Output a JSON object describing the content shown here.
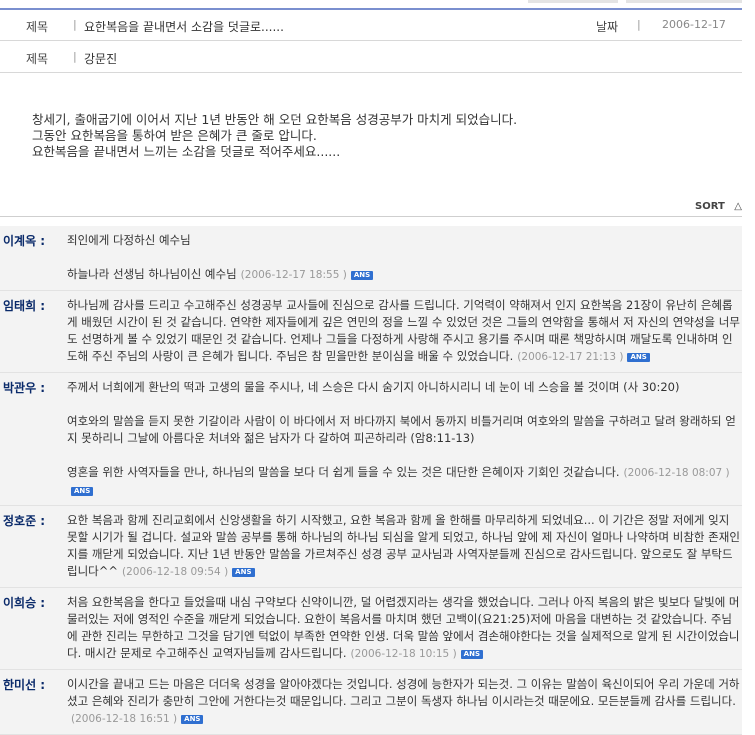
{
  "header": {
    "title_label": "제목",
    "title_value": "요한복음을 끝내면서 소감을 덧글로......",
    "date_label": "날짜",
    "date_value": "2006-12-17",
    "author_label": "제목",
    "author_value": "강문진"
  },
  "post_body": [
    "창세기, 출애굽기에 이어서 지난 1년 반동안 해 오던 요한복음 성경공부가 마치게 되었습니다.",
    "그동안 요한복음을 통하여 받은 은혜가 큰 줄로 압니다.",
    "요한복음을 끝내면서 느끼는 소감을 덧글로 적어주세요......"
  ],
  "sort_label": "SORT",
  "sort_icon": "triangle-up-icon",
  "ans_label": "ANS",
  "colors": {
    "accent": "#7a8fcf",
    "name": "#0a2a6a",
    "ans": "#2f6fd0",
    "comment_bg": "#f3f3f3"
  },
  "comments": [
    {
      "name": "이계옥 :",
      "paragraphs": [
        "죄인에게 다정하신 예수님",
        "하늘나라 선생님 하나님이신 예수님"
      ],
      "date": "(2006-12-17 18:55 )"
    },
    {
      "name": "임태희 :",
      "paragraphs": [
        "하나님께 감사를 드리고 수고해주신 성경공부 교사들에 진심으로 감사를 드립니다. 기억력이 약해져서 인지 요한복음 21장이 유난히 은혜롭게 배웠던 시간이 된 것 같습니다. 연약한 제자들에게 깊은 연민의 정을 느낄 수 있었던 것은 그들의 연약함을 통해서 저 자신의 연약성을 너무도 선명하게 볼 수 있었기 때문인 것 같습니다. 언제나 그들을 다정하게 사랑해 주시고 용기를 주시며 때론 책망하시며 깨달도록 인내하며 인도해 주신 주님의 사랑이 큰 은혜가 됩니다. 주님은 참 믿을만한 분이심을 배울 수 있었습니다."
      ],
      "date": "(2006-12-17 21:13 )"
    },
    {
      "name": "박관우 :",
      "paragraphs": [
        "주께서 너희에게 환난의 떡과 고생의 물을 주시나, 네 스승은 다시 숨기지 아니하시리니 네 눈이 네 스승을 볼 것이며 (사 30:20)",
        "여호와의 말씀을 듣지 못한 기갈이라 사람이 이 바다에서 저 바다까지 북에서 동까지 비틀거리며 여호와의 말씀을 구하려고 달려 왕래하되 얻지 못하리니 그날에 아름다운 처녀와 젊은 남자가 다 갈하여 피곤하리라 (암8:11-13)",
        "영혼을 위한 사역자들을 만나, 하나님의 말씀을 보다 더 쉽게 들을 수 있는 것은 대단한 은혜이자 기회인 것같습니다."
      ],
      "date": "(2006-12-18 08:07 )"
    },
    {
      "name": "정호준 :",
      "paragraphs": [
        "요한 복음과 함께 진리교회에서 신앙생활을 하기 시작했고, 요한 복음과 함께 올 한해를 마무리하게 되었네요... 이 기간은 정말 저에게 잊지 못할 시기가 될 겁니다. 설교와 말씀 공부를 통해 하나님의 하나님 되심을 알게 되었고, 하나님 앞에 제 자신이 얼마나 나약하며 비참한 존재인지를 깨닫게 되었습니다. 지난 1년 반동안 말씀을 가르쳐주신 성경 공부 교사님과 사역자분들께 진심으로 감사드립니다. 앞으로도 잘 부탁드립니다^^"
      ],
      "date": "(2006-12-18 09:54 )"
    },
    {
      "name": "이희승 :",
      "paragraphs": [
        "처음 요한복음을 한다고 들었을때 내심 구약보다 신약이니깐, 덜 어렵겠지라는 생각을 했었습니다. 그러나 아직 복음의 밝은 빛보다 달빛에 머물러있는 저에 영적인 수준을 깨닫게 되었습니다. 요한이 복음서를 마치며 했던 고백이(요21:25)저에 마음을 대변하는 것 같았습니다. 주님에 관한 진리는 무한하고 그것을 담기엔 턱없이 부족한 연약한 인생. 더욱 말씀 앞에서 겸손해야한다는 것을 실제적으로 알게 된 시간이었습니다. 매시간 문제로 수고해주신 교역자님들께 감사드립니다."
      ],
      "date": "(2006-12-18 10:15 )"
    },
    {
      "name": "한미선 :",
      "paragraphs": [
        "이시간을 끝내고 드는 마음은 더더욱 성경을 알아야겠다는 것입니다. 성경에 능한자가 되는것. 그 이유는 말씀이 육신이되어 우리 가운데 거하셨고 은혜와 진리가 충만히 그안에 거한다는것 때문입니다. 그리고 그분이 독생자 하나님 이시라는것 때문에요. 모든분들께 감사를 드립니다."
      ],
      "date": "(2006-12-18 16:51 )"
    }
  ]
}
